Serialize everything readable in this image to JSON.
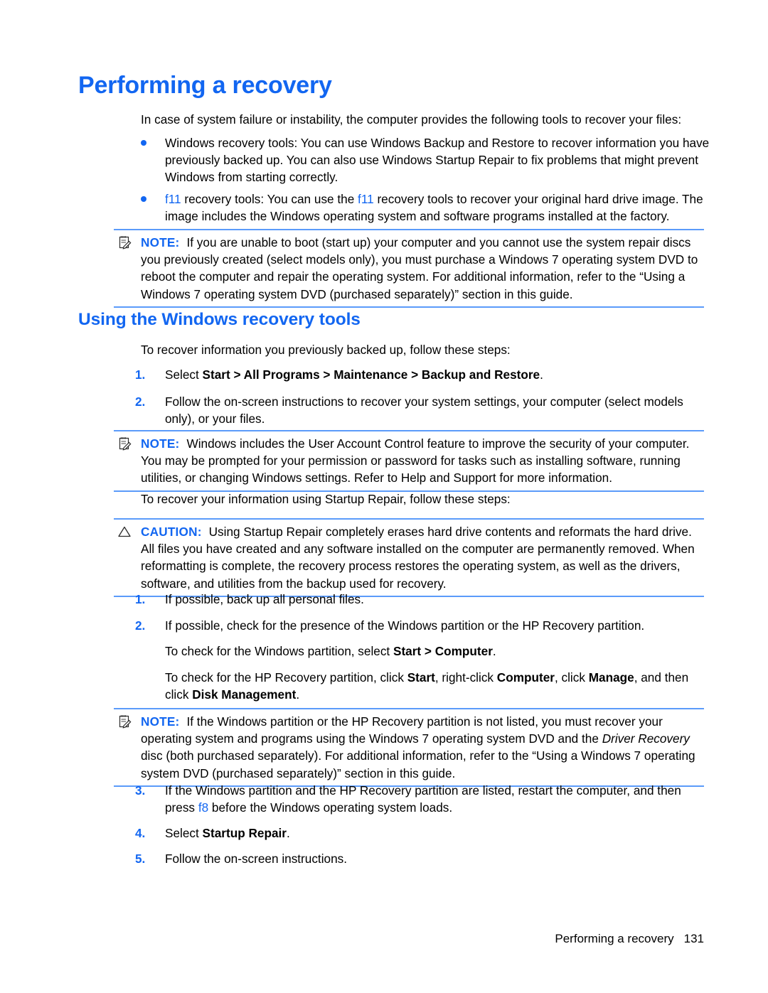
{
  "document": {
    "heading1": "Performing a recovery",
    "heading2": "Using the Windows recovery tools",
    "intro": "In case of system failure or instability, the computer provides the following tools to recover your files:",
    "bullets": [
      {
        "id": "windows-recovery-tools",
        "text": "Windows recovery tools: You can use Windows Backup and Restore to recover information you have previously backed up. You can also use Windows Startup Repair to fix problems that might prevent Windows from starting correctly."
      },
      {
        "id": "f11-recovery-tools",
        "lead": "f11",
        "text_a": " recovery tools: You can use the ",
        "key": "f11",
        "text_b": " recovery tools to recover your original hard drive image. The image includes the Windows operating system and software programs installed at the factory."
      }
    ],
    "note1": {
      "label": "NOTE:",
      "text": "If you are unable to boot (start up) your computer and you cannot use the system repair discs you previously created (select models only), you must purchase a Windows 7 operating system DVD to reboot the computer and repair the operating system. For additional information, refer to the “Using a Windows 7 operating system DVD (purchased separately)” section in this guide."
    },
    "intro2": "To recover information you previously backed up, follow these steps:",
    "steps_a": [
      {
        "marker": "1.",
        "pre": "Select ",
        "bold": "Start > All Programs > Maintenance > Backup and Restore",
        "post": "."
      },
      {
        "marker": "2.",
        "pre": "Follow the on-screen instructions to recover your system settings, your computer (select models only), or your files.",
        "bold": "",
        "post": ""
      }
    ],
    "note2": {
      "label": "NOTE:",
      "text": "Windows includes the User Account Control feature to improve the security of your computer. You may be prompted for your permission or password for tasks such as installing software, running utilities, or changing Windows settings. Refer to Help and Support for more information."
    },
    "intro3": "To recover your information using Startup Repair, follow these steps:",
    "caution": {
      "label": "CAUTION:",
      "text": "Using Startup Repair completely erases hard drive contents and reformats the hard drive. All files you have created and any software installed on the computer are permanently removed. When reformatting is complete, the recovery process restores the operating system, as well as the drivers, software, and utilities from the backup used for recovery."
    },
    "steps_b": [
      {
        "marker": "1.",
        "text": "If possible, back up all personal files."
      },
      {
        "marker": "2.",
        "text": "If possible, check for the presence of the Windows partition or the HP Recovery partition."
      }
    ],
    "substep_1": {
      "pre": "To check for the Windows partition, select ",
      "bold": "Start > Computer",
      "post": "."
    },
    "substep_2": {
      "pre": "To check for the HP Recovery partition, click ",
      "bold1": "Start",
      "mid1": ", right-click ",
      "bold2": "Computer",
      "mid2": ", click ",
      "bold3": "Manage",
      "mid3": ", and then click ",
      "bold4": "Disk Management",
      "post": "."
    },
    "note3": {
      "label": "NOTE:",
      "pre": "If the Windows partition or the HP Recovery partition is not listed, you must recover your operating system and programs using the Windows 7 operating system DVD and the ",
      "italic": "Driver Recovery",
      "post": " disc (both purchased separately). For additional information, refer to the “Using a Windows 7 operating system DVD (purchased separately)” section in this guide."
    },
    "steps_c": [
      {
        "marker": "3.",
        "pre": "If the Windows partition and the HP Recovery partition are listed, restart the computer, and then press ",
        "key": "f8",
        "post": " before the Windows operating system loads."
      },
      {
        "marker": "4.",
        "pre": "Select ",
        "bold": "Startup Repair",
        "post": "."
      },
      {
        "marker": "5.",
        "pre": "Follow the on-screen instructions.",
        "bold": "",
        "post": ""
      }
    ],
    "footer": {
      "title": "Performing a recovery",
      "page": "131"
    },
    "colors": {
      "heading_blue": "#1266f1",
      "rule_blue": "#5b9bfa",
      "body_black": "#000000"
    }
  }
}
